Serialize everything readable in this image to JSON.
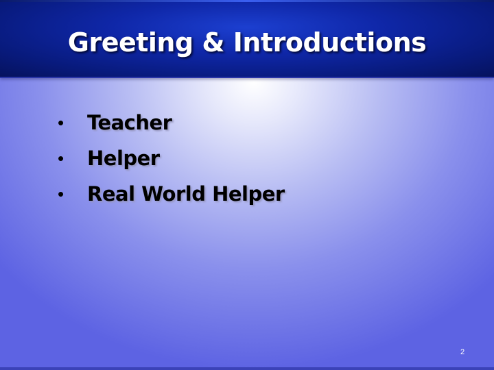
{
  "slide": {
    "title": "Greeting & Introductions",
    "bullets": [
      {
        "marker": "•",
        "text": "Teacher"
      },
      {
        "marker": "•",
        "text": "Helper"
      },
      {
        "marker": "•",
        "text": "Real World Helper"
      }
    ],
    "page_number": "2"
  },
  "colors": {
    "title_bar": "#0b2196",
    "background_center": "#ffffff",
    "background_edge": "#5d63e3",
    "title_text": "#ffffff",
    "bullet_text": "#000000"
  }
}
